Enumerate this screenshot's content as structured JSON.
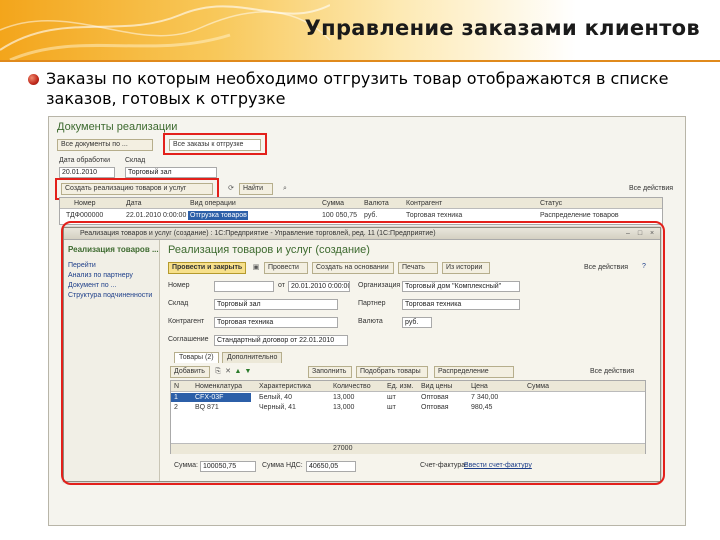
{
  "slide": {
    "title": "Управление заказами клиентов",
    "bullet": "Заказы по которым необходимо отгрузить товар отображаются в списке заказов, готовых к отгрузке"
  },
  "list_form": {
    "title": "Документы реализации",
    "tabs": [
      "Все документы по ...",
      "Все заказы к отгрузке"
    ],
    "filter_label": "Дата обработки",
    "filter_label2": "Склад",
    "filter_value": "20.01.2010",
    "warehouse_value": "Торговый зал",
    "create_button": "Создать реализацию товаров и услуг",
    "find_button": "Найти",
    "more_label": "Все действия",
    "columns": [
      "Номер",
      "Дата",
      "Вид операции",
      "Сумма",
      "Валюта",
      "Контрагент",
      "Статус"
    ],
    "row": [
      "ТДФ000000",
      "22.01.2010 0:00:00",
      "Отгрузка товаров",
      "100 050,75",
      "руб.",
      "Торговая техника",
      "Распределение товаров"
    ]
  },
  "dialog": {
    "titlebar": "Реализация товаров и услуг (создание) : 1С:Предприятие - Управление торговлей, ред. 11 (1С:Предприятие)",
    "side_title": "Реализация товаров ...",
    "side_links": [
      "Перейти",
      "Анализ по партнеру",
      "Документ по ...",
      "Структура подчиненности"
    ],
    "form_title": "Реализация товаров и услуг (создание)",
    "buttons": {
      "post_close": "Провести и закрыть",
      "post": "Провести",
      "create_based": "Создать на основании",
      "print": "Печать",
      "other": "Из истории",
      "all_actions": "Все действия"
    },
    "fields": [
      {
        "label": "Номер",
        "value": ""
      },
      {
        "label": "Склад",
        "value": "Торговый зал"
      },
      {
        "label": "Контрагент",
        "value": "Торговая техника"
      },
      {
        "label": "Соглашение",
        "value": "Стандартный договор от 22.01.2010"
      }
    ],
    "date_label": "от",
    "date_value": "20.01.2010 0:00:00",
    "org_label": "Организация",
    "org_value": "Торговый дом \"Комплексный\"",
    "partner_label": "Партнер",
    "partner_value": "Торговая техника",
    "currency_label": "Валюта",
    "currency_value": "руб.",
    "tabs": [
      "Товары (2)",
      "Дополнительно"
    ],
    "table_toolbar": [
      "Добавить",
      "Заполнить",
      "Подобрать товары",
      "Распределение"
    ],
    "table_more": "Все действия",
    "table_columns": [
      "N",
      "Номенклатура",
      "Характеристика",
      "Количество",
      "Ед. изм.",
      "Вид цены",
      "Цена",
      "Сумма"
    ],
    "table_rows": [
      [
        "1",
        "CFX-03F",
        "Белый, 40",
        "13,000",
        "шт",
        "Оптовая",
        "7 340,00",
        ""
      ],
      [
        "2",
        "BQ 871",
        "Черный, 41",
        "13,000",
        "шт",
        "Оптовая",
        "980,45",
        ""
      ]
    ],
    "table_total": "27000",
    "sum_label": "Сумма:",
    "sum_value": "100050,75",
    "vat_label": "Сумма НДС:",
    "vat_value": "40650,05",
    "invoice_label": "Счет-фактура:",
    "invoice_link": "Ввести счет-фактуру"
  },
  "colors": {
    "highlight": "#e3201b",
    "header_orange": "#f3a51b"
  }
}
